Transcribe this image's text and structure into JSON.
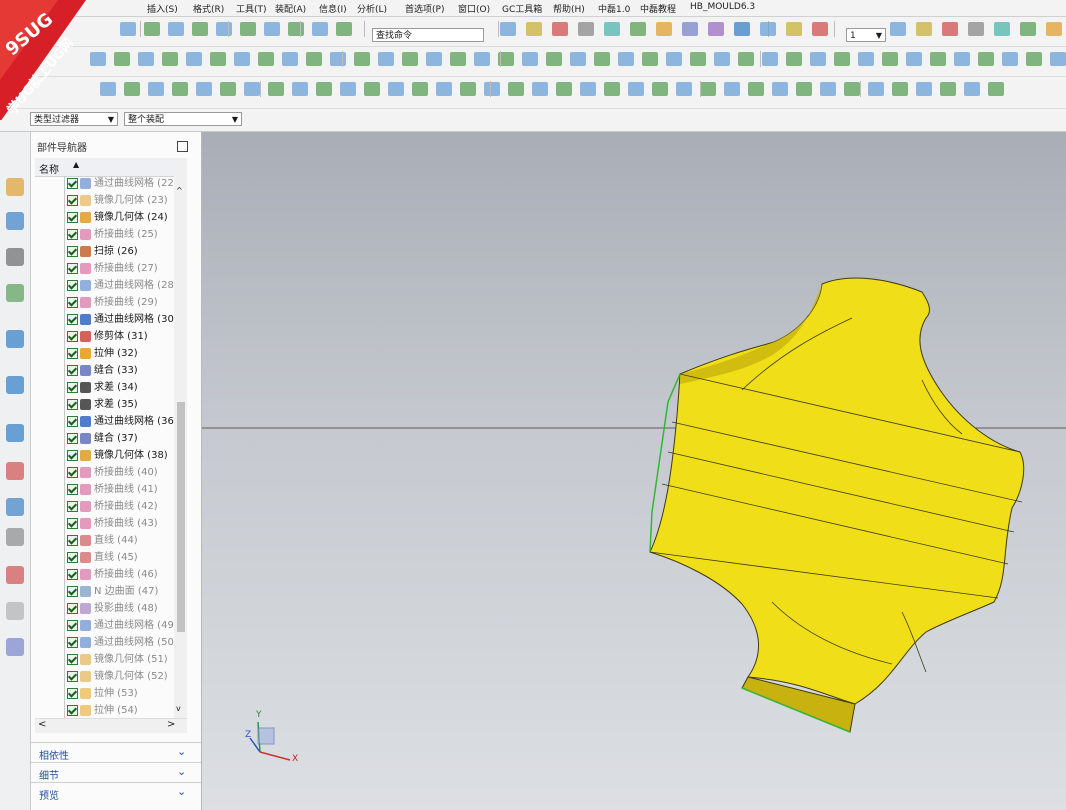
{
  "menubar": [
    "插入(S)",
    "格式(R)",
    "工具(T)",
    "装配(A)",
    "信息(I)",
    "分析(L)",
    "首选项(P)",
    "窗口(O)",
    "GC工具箱",
    "帮助(H)",
    "中磊1.0",
    "中磊教程",
    "HB_MOULD6.3"
  ],
  "toolbar": {
    "search_placeholder": "查找命令",
    "layer_value": "1"
  },
  "selection": {
    "filter_label": "类型过滤器",
    "scope_label": "整个装配"
  },
  "watermark": {
    "line1": "9SUG",
    "line2": "学UG就上UG网"
  },
  "navigator": {
    "title": "部件导航器",
    "column_name": "名称",
    "items": [
      {
        "label": "通过曲线网格 (22",
        "dim": true,
        "kind": "mesh"
      },
      {
        "label": "镜像几何体 (23)",
        "dim": true,
        "kind": "mirror"
      },
      {
        "label": "镜像几何体 (24)",
        "dim": false,
        "kind": "mirror"
      },
      {
        "label": "桥接曲线 (25)",
        "dim": true,
        "kind": "bridge"
      },
      {
        "label": "扫掠 (26)",
        "dim": false,
        "kind": "sweep"
      },
      {
        "label": "桥接曲线 (27)",
        "dim": true,
        "kind": "bridge"
      },
      {
        "label": "通过曲线网格 (28",
        "dim": true,
        "kind": "mesh"
      },
      {
        "label": "桥接曲线 (29)",
        "dim": true,
        "kind": "bridge"
      },
      {
        "label": "通过曲线网格 (30",
        "dim": false,
        "kind": "mesh"
      },
      {
        "label": "修剪体 (31)",
        "dim": false,
        "kind": "trim"
      },
      {
        "label": "拉伸 (32)",
        "dim": false,
        "kind": "extrude"
      },
      {
        "label": "缝合 (33)",
        "dim": false,
        "kind": "sew"
      },
      {
        "label": "求差 (34)",
        "dim": false,
        "kind": "subtract"
      },
      {
        "label": "求差 (35)",
        "dim": false,
        "kind": "subtract"
      },
      {
        "label": "通过曲线网格 (36",
        "dim": false,
        "kind": "mesh"
      },
      {
        "label": "缝合 (37)",
        "dim": false,
        "kind": "sew"
      },
      {
        "label": "镜像几何体 (38)",
        "dim": false,
        "kind": "mirror"
      },
      {
        "label": "桥接曲线 (40)",
        "dim": true,
        "kind": "bridge"
      },
      {
        "label": "桥接曲线 (41)",
        "dim": true,
        "kind": "bridge"
      },
      {
        "label": "桥接曲线 (42)",
        "dim": true,
        "kind": "bridge"
      },
      {
        "label": "桥接曲线 (43)",
        "dim": true,
        "kind": "bridge"
      },
      {
        "label": "直线 (44)",
        "dim": true,
        "kind": "line"
      },
      {
        "label": "直线 (45)",
        "dim": true,
        "kind": "line"
      },
      {
        "label": "桥接曲线 (46)",
        "dim": true,
        "kind": "bridge"
      },
      {
        "label": "N 边曲面 (47)",
        "dim": true,
        "kind": "nside"
      },
      {
        "label": "投影曲线 (48)",
        "dim": true,
        "kind": "project"
      },
      {
        "label": "通过曲线网格 (49",
        "dim": true,
        "kind": "mesh"
      },
      {
        "label": "通过曲线网格 (50",
        "dim": true,
        "kind": "mesh"
      },
      {
        "label": "镜像几何体 (51)",
        "dim": true,
        "kind": "mirror"
      },
      {
        "label": "镜像几何体 (52)",
        "dim": true,
        "kind": "mirror"
      },
      {
        "label": "拉伸 (53)",
        "dim": true,
        "kind": "extrude"
      },
      {
        "label": "拉伸 (54)",
        "dim": true,
        "kind": "extrude"
      }
    ],
    "panels": [
      "相依性",
      "细节",
      "预览"
    ]
  },
  "triad": {
    "x": "X",
    "y": "Y",
    "z": "Z"
  },
  "colors": {
    "model": "#f2e21c",
    "model_edge": "#3a3a1a",
    "selected_edge": "#35b535"
  }
}
